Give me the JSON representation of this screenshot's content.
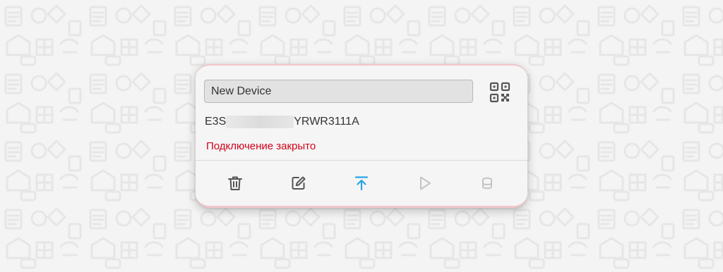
{
  "device": {
    "name": "New Device",
    "name_placeholder": "New Device",
    "serial_prefix": "E3S",
    "serial_suffix": "YRWR3111A",
    "status": "Подключение закрыто"
  },
  "icons": {
    "qr": "qr-code-icon",
    "delete": "trash-icon",
    "edit": "edit-icon",
    "upload": "upload-icon",
    "play": "play-icon",
    "storage": "database-icon"
  },
  "colors": {
    "status_error": "#d0021b",
    "accent": "#2aa3e6",
    "icon_default": "#555555",
    "icon_disabled": "#c4c4c4",
    "card_accent_border": "#f2c6cb"
  }
}
